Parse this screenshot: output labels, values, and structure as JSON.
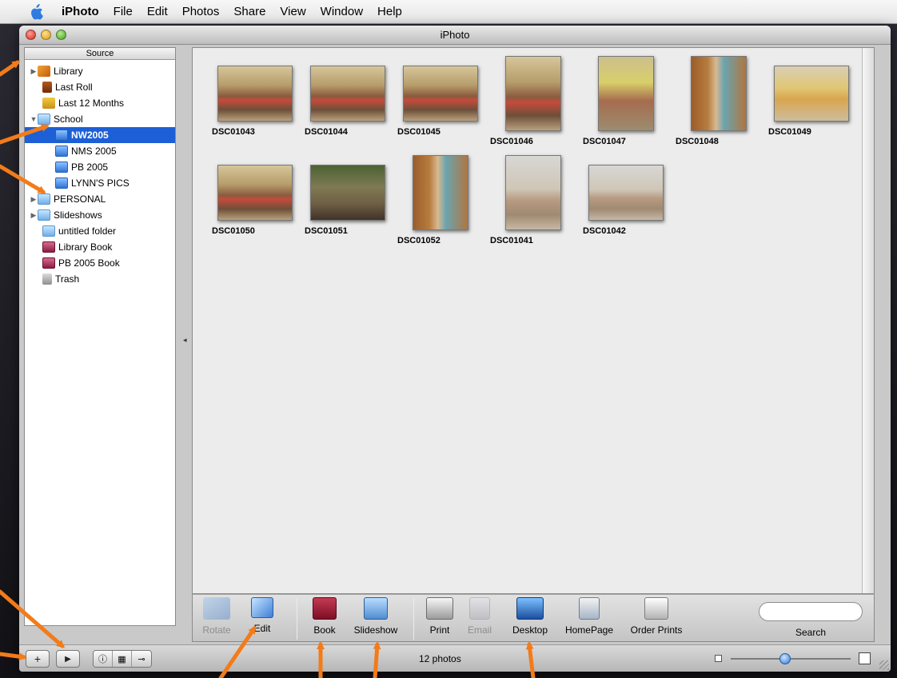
{
  "menubar": {
    "app_name": "iPhoto",
    "items": [
      "File",
      "Edit",
      "Photos",
      "Share",
      "View",
      "Window",
      "Help"
    ]
  },
  "window": {
    "title": "iPhoto"
  },
  "source": {
    "header": "Source",
    "items": [
      {
        "label": "Library",
        "icon": "library-icon",
        "disclosure": "collapsed"
      },
      {
        "label": "Last Roll",
        "icon": "film-roll-icon"
      },
      {
        "label": "Last 12 Months",
        "icon": "calendar-icon"
      },
      {
        "label": "School",
        "icon": "folder-icon",
        "disclosure": "expanded"
      },
      {
        "label": "NW2005",
        "icon": "album-icon",
        "selected": true
      },
      {
        "label": "NMS 2005",
        "icon": "album-icon"
      },
      {
        "label": "PB 2005",
        "icon": "album-icon"
      },
      {
        "label": "LYNN'S PICS",
        "icon": "album-icon"
      },
      {
        "label": "PERSONAL",
        "icon": "folder-icon",
        "disclosure": "collapsed"
      },
      {
        "label": "Slideshows",
        "icon": "folder-icon",
        "disclosure": "collapsed"
      },
      {
        "label": "untitled folder",
        "icon": "folder-icon"
      },
      {
        "label": "Library Book",
        "icon": "book-icon"
      },
      {
        "label": "PB 2005 Book",
        "icon": "book-icon"
      },
      {
        "label": "Trash",
        "icon": "trash-icon"
      }
    ]
  },
  "photos": [
    {
      "name": "DSC01043"
    },
    {
      "name": "DSC01044"
    },
    {
      "name": "DSC01045"
    },
    {
      "name": "DSC01046"
    },
    {
      "name": "DSC01047"
    },
    {
      "name": "DSC01048"
    },
    {
      "name": "DSC01049"
    },
    {
      "name": "DSC01050"
    },
    {
      "name": "DSC01051"
    },
    {
      "name": "DSC01052"
    },
    {
      "name": "DSC01041"
    },
    {
      "name": "DSC01042"
    }
  ],
  "toolbar": {
    "rotate": "Rotate",
    "edit": "Edit",
    "book": "Book",
    "slideshow": "Slideshow",
    "print": "Print",
    "email": "Email",
    "desktop": "Desktop",
    "homepage": "HomePage",
    "order_prints": "Order Prints",
    "search_label": "Search",
    "search_value": ""
  },
  "bottombar": {
    "add_icon": "plus-icon",
    "play_icon": "play-icon",
    "info_icon": "info-icon",
    "calendar_icon": "calendar-grid-icon",
    "keyword_icon": "key-icon",
    "count": "12 photos",
    "zoom_level": 0.45
  },
  "colors": {
    "selection": "#1d5fd6",
    "callout_arrows": "#f27b1a"
  }
}
